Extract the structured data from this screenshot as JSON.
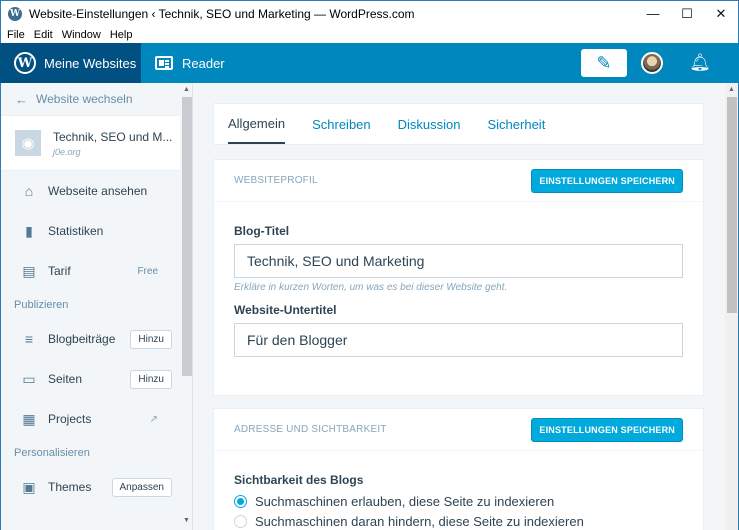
{
  "window": {
    "title": "Website-Einstellungen ‹ Technik, SEO und Marketing — WordPress.com",
    "app_icon": "wordpress-logo",
    "minimize": "—",
    "maximize": "☐",
    "close": "✕"
  },
  "menu": [
    "File",
    "Edit",
    "Window",
    "Help"
  ],
  "masterbar": {
    "my_sites": "Meine Websites",
    "reader": "Reader",
    "write_icon": "write-post-icon",
    "notifications_icon": "notifications-icon"
  },
  "sidebar": {
    "switch_site": "Website wechseln",
    "site": {
      "name": "Technik, SEO und M...",
      "domain": "j0e.org"
    },
    "items_top": [
      {
        "label": "Webseite ansehen",
        "icon": "house-icon"
      },
      {
        "label": "Statistiken",
        "icon": "bar-chart-icon"
      },
      {
        "label": "Tarif",
        "icon": "clipboard-icon",
        "meta": "Free"
      }
    ],
    "section_publish": "Publizieren",
    "items_publish": [
      {
        "label": "Blogbeiträge",
        "icon": "posts-icon",
        "action": "Hinzu"
      },
      {
        "label": "Seiten",
        "icon": "pages-icon",
        "action": "Hinzu"
      },
      {
        "label": "Projects",
        "icon": "portfolio-icon",
        "ext": "↗"
      }
    ],
    "section_personalize": "Personalisieren",
    "items_personalize": [
      {
        "label": "Themes",
        "icon": "themes-icon",
        "action": "Anpassen"
      }
    ]
  },
  "tabs": [
    "Allgemein",
    "Schreiben",
    "Diskussion",
    "Sicherheit"
  ],
  "profile_card": {
    "header": "WEBSITEPROFIL",
    "save_label": "EINSTELLUNGEN SPEICHERN",
    "title_label": "Blog-Titel",
    "title_value": "Technik, SEO und Marketing",
    "title_hint": "Erkläre in kurzen Worten, um was es bei dieser Website geht.",
    "subtitle_label": "Website-Untertitel",
    "subtitle_value": "Für den Blogger"
  },
  "visibility_card": {
    "header": "ADRESSE UND SICHTBARKEIT",
    "save_label": "EINSTELLUNGEN SPEICHERN",
    "visibility_label": "Sichtbarkeit des Blogs",
    "options": [
      "Suchmaschinen erlauben, diese Seite zu indexieren",
      "Suchmaschinen daran hindern, diese Seite zu indexieren"
    ],
    "selected_index": 0
  },
  "colors": {
    "masterbar": "#0087be",
    "masterbar_dark": "#005082",
    "accent": "#00aadc",
    "sidebar_bg": "#f3f6f8"
  }
}
